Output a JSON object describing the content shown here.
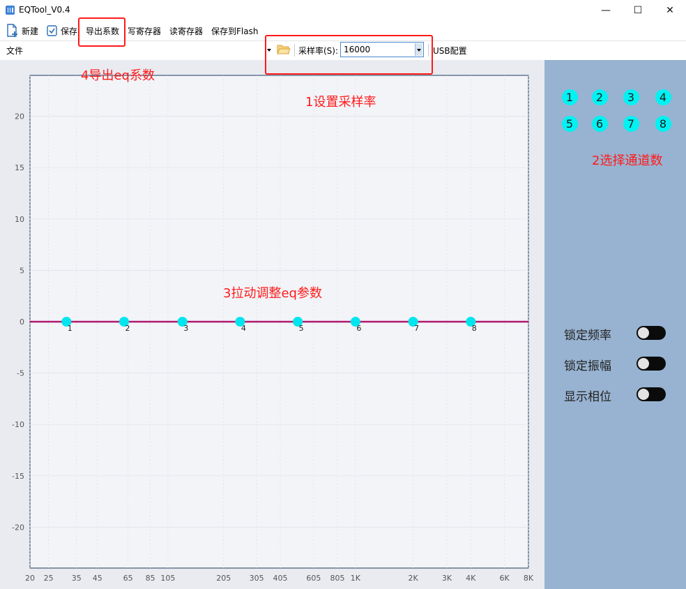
{
  "window": {
    "title": "EQTool_V0.4",
    "minimize_glyph": "—",
    "maximize_glyph": "☐",
    "close_glyph": "✕"
  },
  "toolbar": {
    "new_label": "新建",
    "save_label": "保存",
    "export_label": "导出系数",
    "write_reg_label": "写寄存器",
    "read_reg_label": "读寄存器",
    "save_flash_label": "保存到Flash"
  },
  "filebar": {
    "file_label": "文件",
    "sample_rate_label": "采样率(S):",
    "sample_rate_value": "16000",
    "usb_label": "USB配置"
  },
  "channels": [
    "1",
    "2",
    "3",
    "4",
    "5",
    "6",
    "7",
    "8"
  ],
  "options": [
    {
      "label": "锁定频率",
      "on": false
    },
    {
      "label": "锁定振幅",
      "on": false
    },
    {
      "label": "显示相位",
      "on": false
    }
  ],
  "annotations": {
    "export": "4导出eq系数",
    "sample_rate": "1设置采样率",
    "channels": "2选择通道数",
    "drag": "3拉动调整eq参数"
  },
  "colors": {
    "curve": "#b0176e",
    "handle": "#00e5ee",
    "accent": "#ff1a1a",
    "right_panel": "#98b3d1"
  },
  "chart_data": {
    "type": "line",
    "xscale": "log",
    "xlim": [
      20,
      8000
    ],
    "ylim": [
      -24,
      24
    ],
    "x_ticks": [
      {
        "v": 20,
        "t": "20"
      },
      {
        "v": 25,
        "t": "25"
      },
      {
        "v": 35,
        "t": "35"
      },
      {
        "v": 45,
        "t": "45"
      },
      {
        "v": 65,
        "t": "65"
      },
      {
        "v": 85,
        "t": "85"
      },
      {
        "v": 105,
        "t": "105"
      },
      {
        "v": 205,
        "t": "205"
      },
      {
        "v": 305,
        "t": "305"
      },
      {
        "v": 405,
        "t": "405"
      },
      {
        "v": 605,
        "t": "605"
      },
      {
        "v": 805,
        "t": "805"
      },
      {
        "v": 1000,
        "t": "1K"
      },
      {
        "v": 2000,
        "t": "2K"
      },
      {
        "v": 3000,
        "t": "3K"
      },
      {
        "v": 4000,
        "t": "4K"
      },
      {
        "v": 6000,
        "t": "6K"
      },
      {
        "v": 8000,
        "t": "8K"
      }
    ],
    "y_ticks": [
      20,
      15,
      10,
      5,
      0,
      -5,
      -10,
      -15,
      -20
    ],
    "curve": {
      "x": [
        20,
        8000
      ],
      "y": [
        0,
        0
      ]
    },
    "handles": [
      {
        "label": "1",
        "freq": 31,
        "gain": 0
      },
      {
        "label": "2",
        "freq": 62,
        "gain": 0
      },
      {
        "label": "3",
        "freq": 125,
        "gain": 0
      },
      {
        "label": "4",
        "freq": 250,
        "gain": 0
      },
      {
        "label": "5",
        "freq": 500,
        "gain": 0
      },
      {
        "label": "6",
        "freq": 1000,
        "gain": 0
      },
      {
        "label": "7",
        "freq": 2000,
        "gain": 0
      },
      {
        "label": "8",
        "freq": 4000,
        "gain": 0
      }
    ]
  }
}
